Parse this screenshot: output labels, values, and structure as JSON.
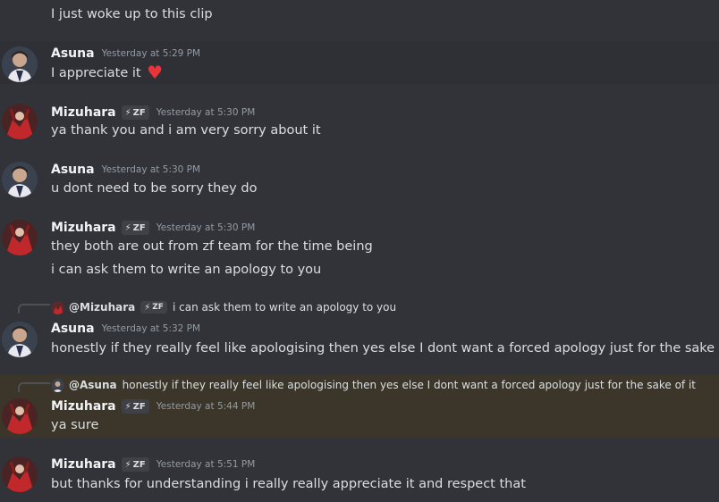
{
  "messages": [
    {
      "text": "I just woke up to this clip"
    },
    {
      "author": "Asuna",
      "time": "Yesterday at 5:29 PM",
      "text": "I appreciate it",
      "emoji": "heart-emoji"
    },
    {
      "author": "Mizuhara",
      "badge": "ZF",
      "time": "Yesterday at 5:30 PM",
      "text": "ya thank you and i am very sorry about it"
    },
    {
      "author": "Asuna",
      "time": "Yesterday at 5:30 PM",
      "text": "u dont need to be sorry they do"
    },
    {
      "author": "Mizuhara",
      "badge": "ZF",
      "time": "Yesterday at 5:30 PM",
      "text": "they both are out from zf team for the time being",
      "text2": "i can ask them to write an apology to you"
    },
    {
      "reply_to": "@Mizuhara",
      "reply_badge": "ZF",
      "reply_text": "i can ask them to write an apology to you",
      "author": "Asuna",
      "time": "Yesterday at 5:32 PM",
      "text": "honestly if they really feel like apologising then yes else I dont want a forced apology just for the sake of it"
    },
    {
      "reply_to": "@Asuna",
      "reply_text": "honestly if they really feel like apologising then yes else I dont want a forced apology just for the sake of it",
      "author": "Mizuhara",
      "badge": "ZF",
      "time": "Yesterday at 5:44 PM",
      "text": "ya sure"
    },
    {
      "author": "Mizuhara",
      "badge": "ZF",
      "time": "Yesterday at 5:51 PM",
      "text": "but thanks for understanding i really really appreciate it and respect that"
    }
  ],
  "colors": {
    "background": "#313338",
    "mention_highlight": "#3b3629",
    "heart": "#e8343a"
  }
}
